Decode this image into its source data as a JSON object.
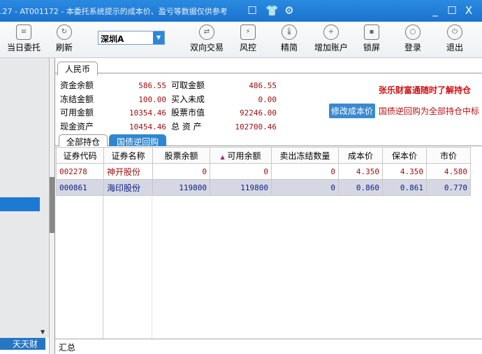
{
  "title": ".27 - AT001172 - 本委托系统提示的成本价、盈亏等数据仅供参考",
  "window_controls": [
    "_",
    "☐",
    "X"
  ],
  "toolbar": {
    "items": [
      {
        "label": "当日委托",
        "icon": "document-icon"
      },
      {
        "label": "刷新",
        "icon": "refresh-icon"
      },
      {
        "label": "双向交易",
        "icon": "swap-icon"
      },
      {
        "label": "风控",
        "icon": "shield-icon"
      },
      {
        "label": "精简",
        "icon": "thermometer-icon"
      },
      {
        "label": "增加账户",
        "icon": "add-user-icon"
      },
      {
        "label": "锁屏",
        "icon": "lock-icon"
      },
      {
        "label": "登录",
        "icon": "user-icon"
      },
      {
        "label": "退出",
        "icon": "power-icon"
      }
    ],
    "market": "深圳A"
  },
  "left": {
    "bottom_tabs": [
      "天天财"
    ]
  },
  "currency_tab": "人民币",
  "funds": [
    {
      "label": "资金余额",
      "value": "586.55",
      "label2": "可取金额",
      "value2": "486.55"
    },
    {
      "label": "冻结金额",
      "value": "100.00",
      "label2": "买入未成",
      "value2": "0.00"
    },
    {
      "label": "可用金额",
      "value": "10354.46",
      "label2": "股票市值",
      "value2": "92246.00"
    },
    {
      "label": "现金资产",
      "value": "10454.46",
      "label2": "总 资 产",
      "value2": "102700.46"
    }
  ],
  "promo": "张乐财富通随时了解持仓",
  "modify_cost_button": "修改成本价",
  "note": "国债逆回购为全部持仓中标",
  "tabs": [
    "全部持仓",
    "国债逆回购"
  ],
  "table": {
    "columns": [
      "证券代码",
      "证券名称",
      "股票余额",
      "可用余额",
      "卖出冻结数量",
      "成本价",
      "保本价",
      "市价"
    ],
    "sort_indicator": "▲",
    "rows": [
      [
        "002278",
        "神开股份",
        "0",
        "0",
        "0",
        "4.350",
        "4.350",
        "4.580"
      ],
      [
        "000861",
        "海印股份",
        "119800",
        "119800",
        "0",
        "0.860",
        "0.861",
        "0.770"
      ]
    ],
    "summary_label": "汇总"
  }
}
